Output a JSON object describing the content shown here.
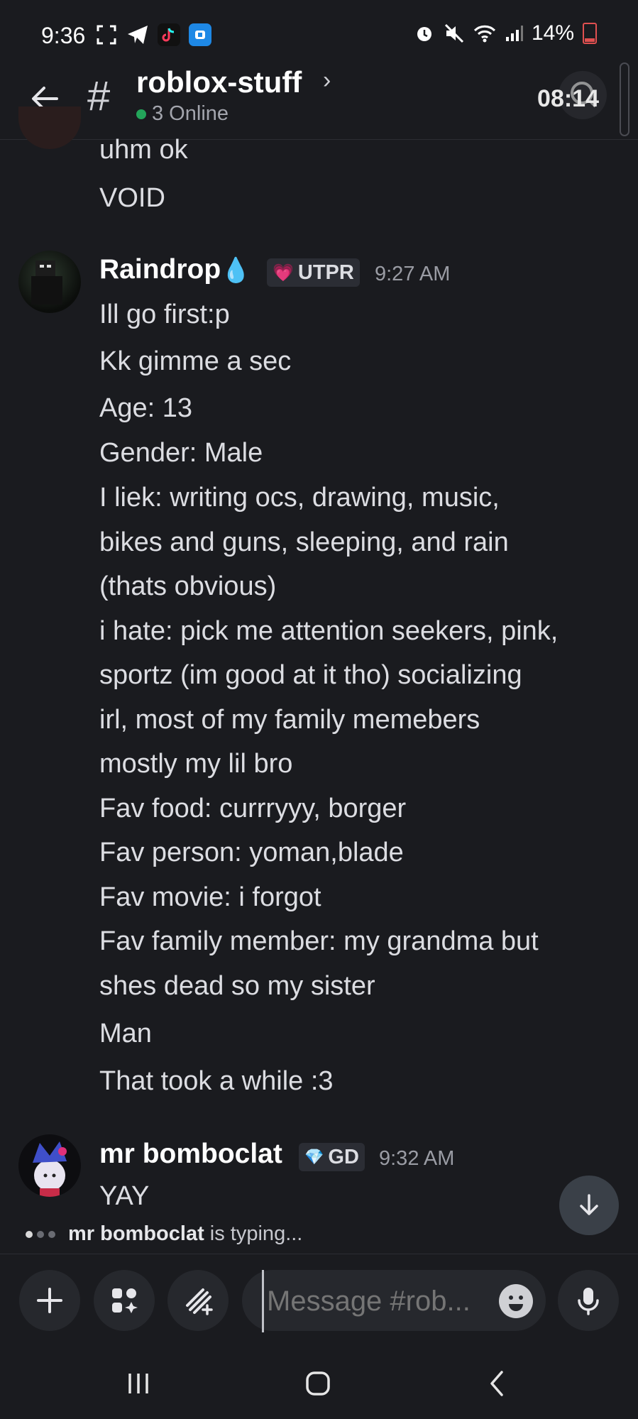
{
  "status_bar": {
    "time": "9:36",
    "battery": "14%",
    "icons_left": [
      "screenshot-icon",
      "telegram-icon",
      "tiktok-icon",
      "blue-app-icon"
    ],
    "icons_right": [
      "alarm-icon",
      "mute-icon",
      "wifi-icon",
      "signal-icon",
      "battery-icon"
    ]
  },
  "header": {
    "channel_name": "roblox-stuff",
    "online_text": "3 Online",
    "overlay_time": "08:14"
  },
  "messages_prev": {
    "lines": [
      "uhm ok",
      "VOID"
    ]
  },
  "message1": {
    "author": "Raindrop",
    "author_emoji": "💧",
    "tag": "UTPR",
    "tag_emoji": "💗",
    "time": "9:27 AM",
    "lines": [
      "Ill go first:p",
      "Kk gimme a sec",
      "Age: 13",
      "Gender: Male",
      "I liek: writing ocs, drawing, music,",
      "bikes and guns, sleeping, and rain",
      "(thats obvious)",
      "i hate: pick me attention seekers, pink,",
      "sportz (im good at it tho) socializing",
      "irl, most of my family memebers",
      "mostly my lil bro",
      "Fav food: currryyy, borger",
      "Fav person: yoman,blade",
      "Fav movie: i forgot",
      "Fav family member: my grandma but",
      "shes dead so my sister",
      "Man",
      "That took a while :3"
    ]
  },
  "message2": {
    "author": "mr bomboclat",
    "tag": "GD",
    "tag_emoji": "💎",
    "time": "9:32 AM",
    "lines": [
      "YAY"
    ]
  },
  "typing": {
    "user": "mr bomboclat",
    "suffix": " is typing..."
  },
  "composer": {
    "placeholder": "Message #rob..."
  },
  "colors": {
    "background": "#1a1b1f",
    "online": "#23a55a",
    "input_bg": "#26282d"
  }
}
